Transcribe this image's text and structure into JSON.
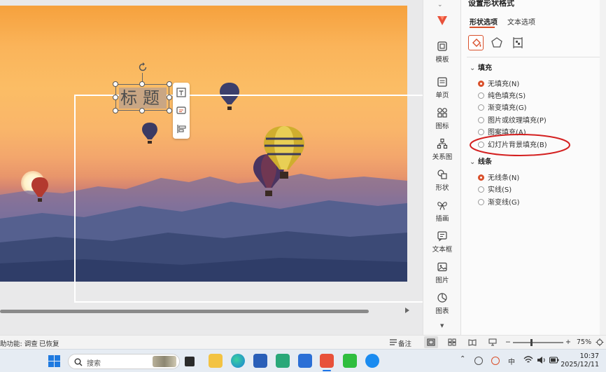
{
  "slide": {
    "title_text": "标题"
  },
  "pane": {
    "title": "设置形状格式",
    "tabs": [
      {
        "label": "形状选项",
        "active": true
      },
      {
        "label": "文本选项",
        "active": false
      }
    ],
    "sections": {
      "fill": {
        "label": "填充",
        "options": [
          {
            "label": "无填充(N)",
            "selected": true
          },
          {
            "label": "纯色填充(S)",
            "selected": false
          },
          {
            "label": "渐变填充(G)",
            "selected": false
          },
          {
            "label": "图片或纹理填充(P)",
            "selected": false
          },
          {
            "label": "图案填充(A)",
            "selected": false
          },
          {
            "label": "幻灯片背景填充(B)",
            "selected": false
          }
        ]
      },
      "line": {
        "label": "线条",
        "options": [
          {
            "label": "无线条(N)",
            "selected": true
          },
          {
            "label": "实线(S)",
            "selected": false
          },
          {
            "label": "渐变线(G)",
            "selected": false
          }
        ]
      }
    },
    "accent_color": "#d9502b",
    "annotation_color": "#d42020"
  },
  "tool_column": {
    "items": [
      {
        "label": "模板",
        "icon": "template-icon"
      },
      {
        "label": "单页",
        "icon": "single-page-icon"
      },
      {
        "label": "图标",
        "icon": "icons-library-icon"
      },
      {
        "label": "关系图",
        "icon": "relationship-diagram-icon"
      },
      {
        "label": "形状",
        "icon": "shapes-icon"
      },
      {
        "label": "插画",
        "icon": "illustration-icon"
      },
      {
        "label": "文本框",
        "icon": "textbox-icon"
      },
      {
        "label": "图片",
        "icon": "picture-icon"
      },
      {
        "label": "图表",
        "icon": "chart-icon"
      }
    ]
  },
  "status_bar": {
    "left_text": "助功能: 调查",
    "recovered_text": "已恢复",
    "notes_label": "备注",
    "zoom_minus": "−",
    "zoom_plus": "+",
    "zoom_level": "75%"
  },
  "taskbar": {
    "search_placeholder": "搜索",
    "tray_ime": "中",
    "time": "10:37",
    "date": "2025/12/11"
  }
}
